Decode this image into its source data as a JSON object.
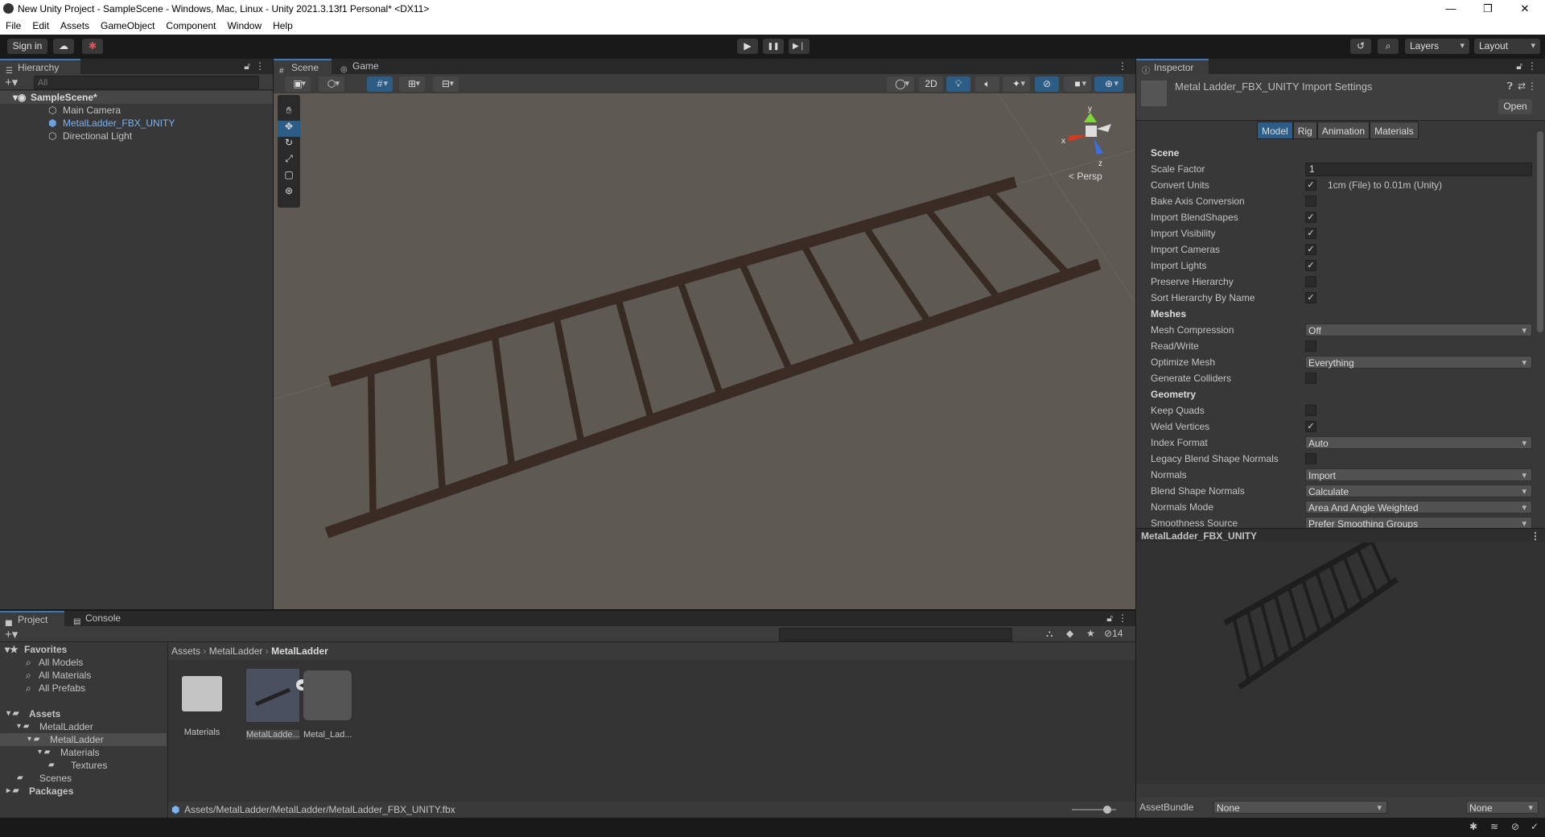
{
  "window": {
    "title": "New Unity Project - SampleScene - Windows, Mac, Linux - Unity 2021.3.13f1 Personal* <DX11>",
    "minimize": "—",
    "restore": "❐",
    "close": "✕"
  },
  "menu": [
    "File",
    "Edit",
    "Assets",
    "GameObject",
    "Component",
    "Window",
    "Help"
  ],
  "toolbar": {
    "sign_in": "Sign in",
    "play": "▶",
    "pause": "❚❚",
    "step": "▶❘",
    "layers": "Layers",
    "layout": "Layout"
  },
  "hierarchy": {
    "tab": "Hierarchy",
    "search_placeholder": "All",
    "scene": "SampleScene*",
    "items": [
      "Main Camera",
      "MetalLadder_FBX_UNITY",
      "Directional Light"
    ]
  },
  "scene_view": {
    "tabs": [
      "Scene",
      "Game"
    ],
    "btn_2d": "2D",
    "persp": "< Persp",
    "axes": {
      "x": "x",
      "y": "y",
      "z": "z"
    },
    "rungs": 11
  },
  "inspector": {
    "tab": "Inspector",
    "title": "Metal Ladder_FBX_UNITY Import Settings",
    "open": "Open",
    "tabs": [
      "Model",
      "Rig",
      "Animation",
      "Materials"
    ],
    "active_tab": "Model",
    "rows": [
      {
        "type": "header",
        "label": "Scene"
      },
      {
        "type": "text",
        "label": "Scale Factor",
        "value": "1"
      },
      {
        "type": "check",
        "label": "Convert Units",
        "checked": true,
        "note": "1cm (File) to 0.01m (Unity)"
      },
      {
        "type": "check",
        "label": "Bake Axis Conversion",
        "checked": false
      },
      {
        "type": "check",
        "label": "Import BlendShapes",
        "checked": true
      },
      {
        "type": "check",
        "label": "Import Visibility",
        "checked": true
      },
      {
        "type": "check",
        "label": "Import Cameras",
        "checked": true
      },
      {
        "type": "check",
        "label": "Import Lights",
        "checked": true
      },
      {
        "type": "check",
        "label": "Preserve Hierarchy",
        "checked": false
      },
      {
        "type": "check",
        "label": "Sort Hierarchy By Name",
        "checked": true
      },
      {
        "type": "header",
        "label": "Meshes"
      },
      {
        "type": "dropdown",
        "label": "Mesh Compression",
        "value": "Off"
      },
      {
        "type": "check",
        "label": "Read/Write",
        "checked": false
      },
      {
        "type": "dropdown",
        "label": "Optimize Mesh",
        "value": "Everything"
      },
      {
        "type": "check",
        "label": "Generate Colliders",
        "checked": false
      },
      {
        "type": "header",
        "label": "Geometry"
      },
      {
        "type": "check",
        "label": "Keep Quads",
        "checked": false
      },
      {
        "type": "check",
        "label": "Weld Vertices",
        "checked": true
      },
      {
        "type": "dropdown",
        "label": "Index Format",
        "value": "Auto"
      },
      {
        "type": "check",
        "label": "Legacy Blend Shape Normals",
        "checked": false
      },
      {
        "type": "dropdown",
        "label": "Normals",
        "value": "Import"
      },
      {
        "type": "dropdown",
        "label": "Blend Shape Normals",
        "value": "Calculate"
      },
      {
        "type": "dropdown",
        "label": "Normals Mode",
        "value": "Area And Angle Weighted"
      },
      {
        "type": "dropdown",
        "label": "Smoothness Source",
        "value": "Prefer Smoothing Groups"
      }
    ],
    "preview_title": "MetalLadder_FBX_UNITY",
    "asset_bundle_label": "AssetBundle",
    "asset_bundle_value": "None",
    "asset_bundle_variant": "None"
  },
  "project": {
    "tabs": [
      "Project",
      "Console"
    ],
    "hidden_count": "14",
    "favorites": {
      "label": "Favorites",
      "items": [
        "All Models",
        "All Materials",
        "All Prefabs"
      ]
    },
    "tree": [
      {
        "label": "Assets",
        "depth": 0,
        "bold": true
      },
      {
        "label": "MetalLadder",
        "depth": 1
      },
      {
        "label": "MetalLadder",
        "depth": 2,
        "selected": true
      },
      {
        "label": "Materials",
        "depth": 3
      },
      {
        "label": "Textures",
        "depth": 4
      },
      {
        "label": "Scenes",
        "depth": 1
      },
      {
        "label": "Packages",
        "depth": 0,
        "bold": true
      }
    ],
    "breadcrumb": [
      "Assets",
      "MetalLadder",
      "MetalLadder"
    ],
    "assets": [
      "Materials",
      "MetalLadde...",
      "Metal_Lad..."
    ],
    "path": "Assets/MetalLadder/MetalLadder/MetalLadder_FBX_UNITY.fbx"
  }
}
